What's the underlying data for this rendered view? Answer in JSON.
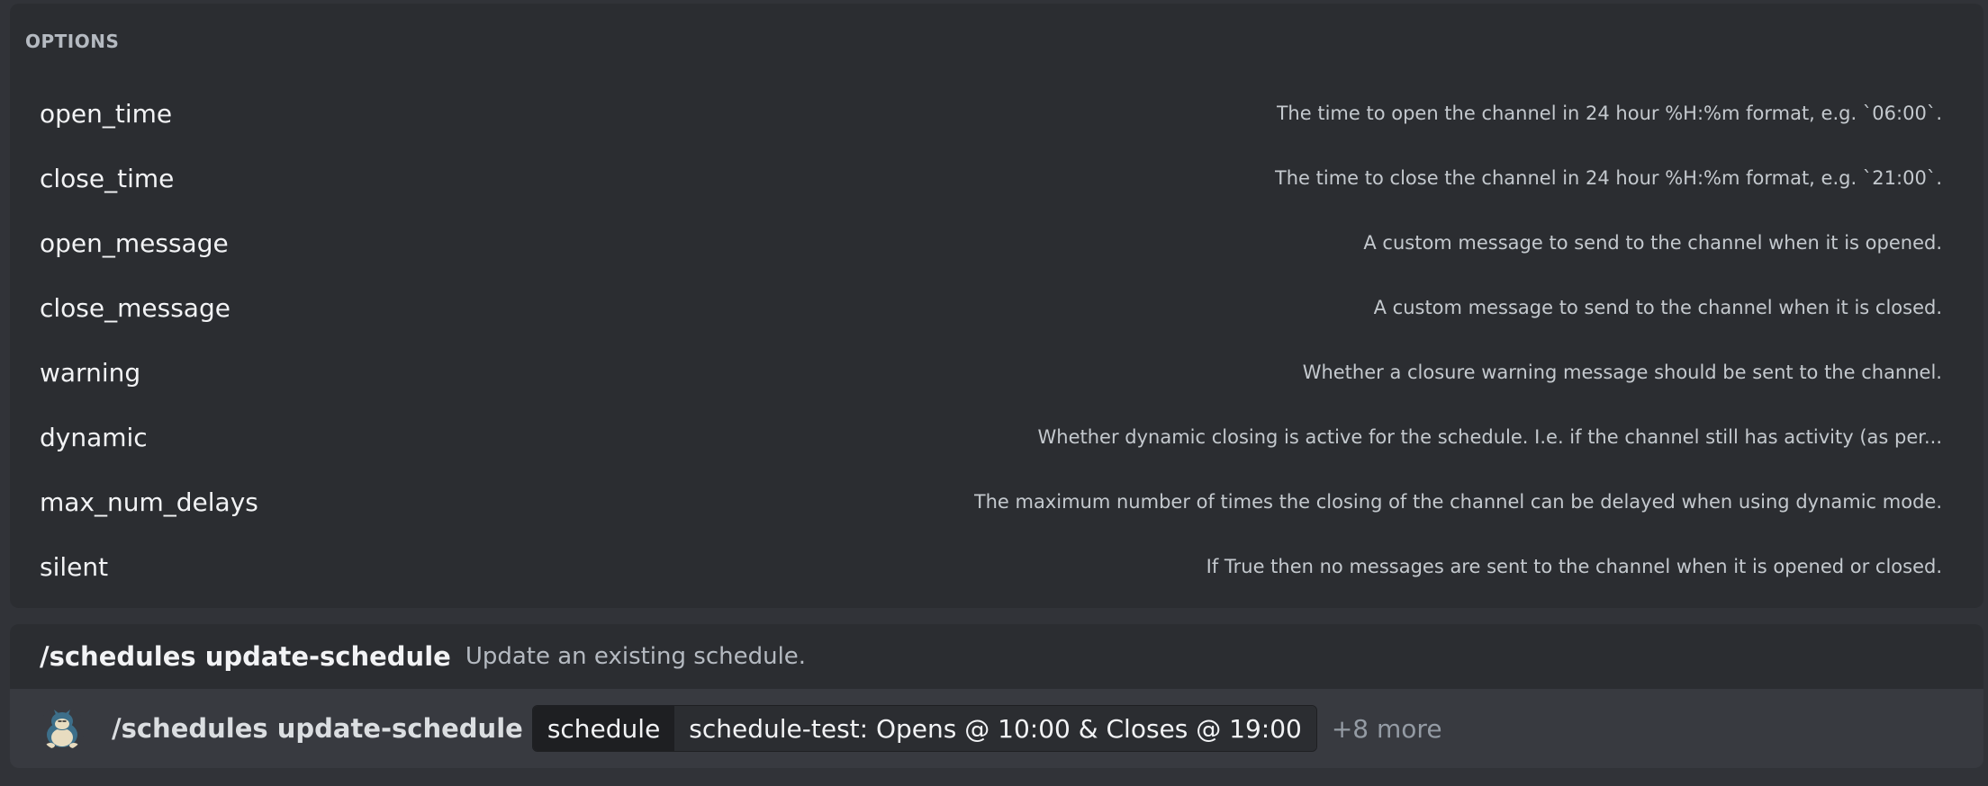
{
  "options_panel": {
    "header": "OPTIONS",
    "options": [
      {
        "name": "open_time",
        "description": "The time to open the channel in 24 hour %H:%m format, e.g. `06:00`."
      },
      {
        "name": "close_time",
        "description": "The time to close the channel in 24 hour %H:%m format, e.g. `21:00`."
      },
      {
        "name": "open_message",
        "description": "A custom message to send to the channel when it is opened."
      },
      {
        "name": "close_message",
        "description": "A custom message to send to the channel when it is closed."
      },
      {
        "name": "warning",
        "description": "Whether a closure warning message should be sent to the channel."
      },
      {
        "name": "dynamic",
        "description": "Whether dynamic closing is active for the schedule. I.e. if the channel still has activity (as per..."
      },
      {
        "name": "max_num_delays",
        "description": "The maximum number of times the closing of the channel can be delayed when using dynamic mode."
      },
      {
        "name": "silent",
        "description": "If True then no messages are sent to the channel when it is opened or closed."
      }
    ]
  },
  "command_suggestion": {
    "name": "/schedules update-schedule",
    "description": "Update an existing schedule."
  },
  "input_bar": {
    "avatar_icon": "snorlax-avatar-icon",
    "command": "/schedules update-schedule",
    "option_key": "schedule",
    "option_value": "schedule-test: Opens @ 10:00 & Closes @ 19:00",
    "more": "+8 more"
  },
  "colors": {
    "background": "#313338",
    "panel": "#2b2d31",
    "input_bar": "#383a40",
    "pill_key": "#1e1f22",
    "text_primary": "#f2f3f5",
    "text_muted": "#b5bac1"
  }
}
